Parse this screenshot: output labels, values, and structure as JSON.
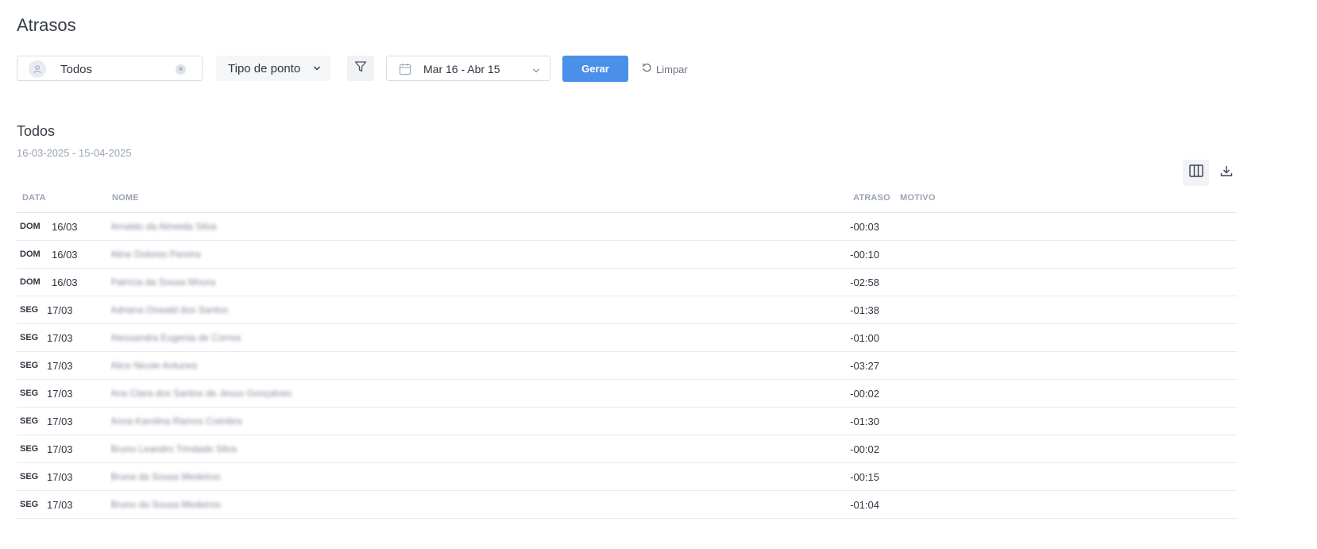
{
  "page": {
    "title": "Atrasos"
  },
  "toolbar": {
    "user_value": "Todos",
    "clear_symbol": "×",
    "tipo_label": "Tipo de ponto",
    "date_range": "Mar 16 - Abr 15",
    "gerar_label": "Gerar",
    "limpar_label": "Limpar"
  },
  "section": {
    "title": "Todos",
    "range": "16-03-2025 - 15-04-2025"
  },
  "table": {
    "headers": {
      "data": "DATA",
      "nome": "NOME",
      "atraso": "ATRASO",
      "motivo": "MOTIVO"
    },
    "rows": [
      {
        "dow": "DOM",
        "date": "16/03",
        "name": "Arnaldo da Almeida Silva",
        "atraso": "-00:03",
        "motivo": ""
      },
      {
        "dow": "DOM",
        "date": "16/03",
        "name": "Aline Dolores Pereira",
        "atraso": "-00:10",
        "motivo": ""
      },
      {
        "dow": "DOM",
        "date": "16/03",
        "name": "Patrícia da Sousa Moura",
        "atraso": "-02:58",
        "motivo": ""
      },
      {
        "dow": "SEG",
        "date": "17/03",
        "name": "Adriana Oswald dos Santos",
        "atraso": "-01:38",
        "motivo": ""
      },
      {
        "dow": "SEG",
        "date": "17/03",
        "name": "Alessandra Eugenia de Correa",
        "atraso": "-01:00",
        "motivo": ""
      },
      {
        "dow": "SEG",
        "date": "17/03",
        "name": "Alice Nicole Antunes",
        "atraso": "-03:27",
        "motivo": ""
      },
      {
        "dow": "SEG",
        "date": "17/03",
        "name": "Ana Clara dos Santos de Jesus Gonçalves",
        "atraso": "-00:02",
        "motivo": ""
      },
      {
        "dow": "SEG",
        "date": "17/03",
        "name": "Anna Karolina Ramos Coimbra",
        "atraso": "-01:30",
        "motivo": ""
      },
      {
        "dow": "SEG",
        "date": "17/03",
        "name": "Bruno Leandro Trindade Silva",
        "atraso": "-00:02",
        "motivo": ""
      },
      {
        "dow": "SEG",
        "date": "17/03",
        "name": "Bruna da Sousa Medeiros",
        "atraso": "-00:15",
        "motivo": ""
      },
      {
        "dow": "SEG",
        "date": "17/03",
        "name": "Bruno da Sousa Medeiros",
        "atraso": "-01:04",
        "motivo": ""
      }
    ]
  },
  "colors": {
    "primary": "#4a90e8",
    "muted": "#9aa4b5",
    "text": "#2f3542"
  },
  "icons": {
    "avatar": "user-icon",
    "filter": "filter-icon",
    "calendar": "calendar-icon",
    "refresh": "refresh-icon",
    "columns": "columns-icon",
    "download": "download-icon"
  }
}
